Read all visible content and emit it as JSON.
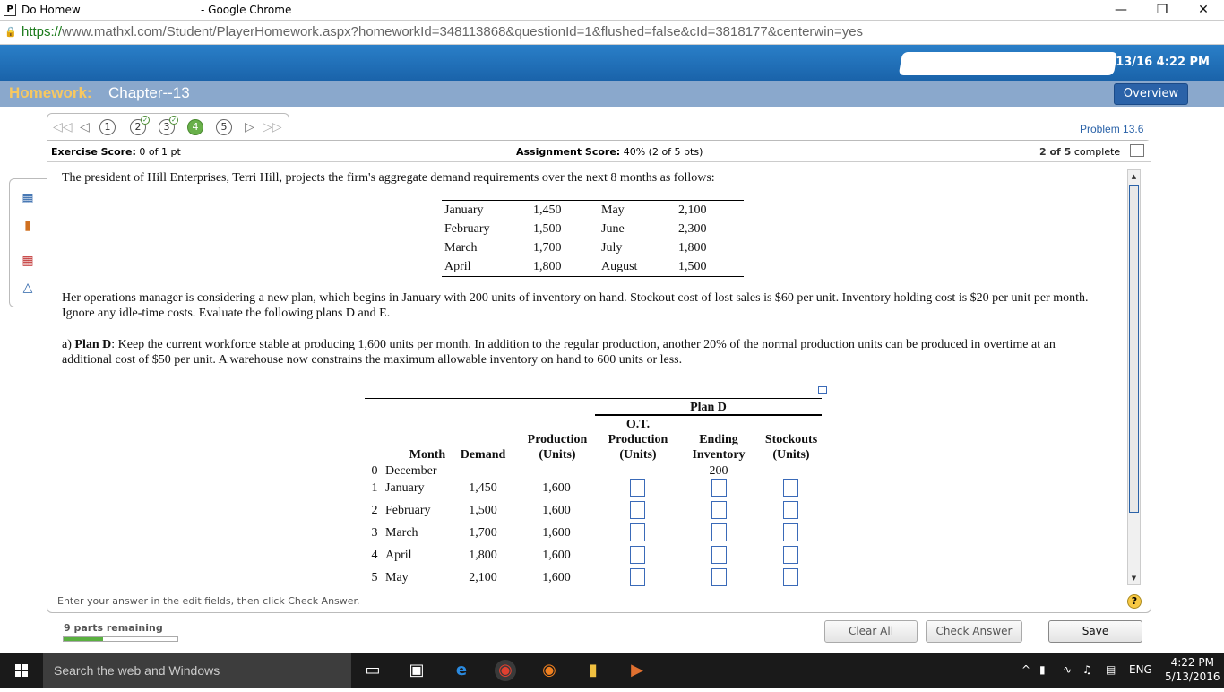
{
  "browser": {
    "favicon": "P",
    "tab_title": "Do Homew",
    "app_title": "- Google Chrome",
    "url_proto": "https://",
    "url_rest": "www.mathxl.com/Student/PlayerHomework.aspx?homeworkId=348113868&questionId=1&flushed=false&cId=3818177&centerwin=yes",
    "minimize": "—",
    "restore": "❐",
    "close": "✕"
  },
  "banner": {
    "datetime": "5/13/16 4:22 PM"
  },
  "homework": {
    "label": "Homework:",
    "chapter": "Chapter--13",
    "overview": "Overview"
  },
  "nav": {
    "questions": [
      "1",
      "2",
      "3",
      "4",
      "5"
    ],
    "problem": "Problem 13.6"
  },
  "score": {
    "exercise_label": "Exercise Score:",
    "exercise_value": "0 of 1 pt",
    "assignment_label": "Assignment Score:",
    "assignment_value": "40% (2 of 5 pts)",
    "complete_bold": "2 of 5",
    "complete_text": "complete"
  },
  "question": {
    "intro": "The president of Hill Enterprises, Terri Hill, projects the firm's aggregate demand requirements over the next 8 months as follows:",
    "demand": [
      {
        "m1": "January",
        "v1": "1,450",
        "m2": "May",
        "v2": "2,100"
      },
      {
        "m1": "February",
        "v1": "1,500",
        "m2": "June",
        "v2": "2,300"
      },
      {
        "m1": "March",
        "v1": "1,700",
        "m2": "July",
        "v2": "1,800"
      },
      {
        "m1": "April",
        "v1": "1,800",
        "m2": "August",
        "v2": "1,500"
      }
    ],
    "para2": "Her operations manager is considering a new plan, which begins in January with 200 units of inventory on hand. Stockout cost of lost sales is $60 per unit. Inventory holding cost is $20 per unit per month. Ignore any idle-time costs. Evaluate the following plans D and E.",
    "para3_prefix": "a) ",
    "para3_bold": "Plan D",
    "para3_rest": ": Keep the current workforce stable at producing 1,600 units per month. In addition to the regular production, another 20% of the normal production units can be produced in overtime at an additional cost of $50 per unit. A warehouse now constrains the maximum allowable inventory on hand to 600 units or less."
  },
  "plan": {
    "title": "Plan D",
    "headers": {
      "month": "Month",
      "demand": "Demand",
      "production": [
        "Production",
        "(Units)"
      ],
      "ot": [
        "O.T.",
        "Production",
        "(Units)"
      ],
      "ending": [
        "Ending",
        "Inventory"
      ],
      "stockouts": [
        "Stockouts",
        "(Units)"
      ]
    },
    "rows": [
      {
        "num": "0",
        "month": "December",
        "demand": "",
        "production": "",
        "ending": "200"
      },
      {
        "num": "1",
        "month": "January",
        "demand": "1,450",
        "production": "1,600"
      },
      {
        "num": "2",
        "month": "February",
        "demand": "1,500",
        "production": "1,600"
      },
      {
        "num": "3",
        "month": "March",
        "demand": "1,700",
        "production": "1,600"
      },
      {
        "num": "4",
        "month": "April",
        "demand": "1,800",
        "production": "1,600"
      },
      {
        "num": "5",
        "month": "May",
        "demand": "2,100",
        "production": "1,600"
      }
    ]
  },
  "footer": {
    "instruction": "Enter your answer in the edit fields, then click Check Answer.",
    "help": "?",
    "parts": "9 parts remaining",
    "progress_fraction": 0.35,
    "clear": "Clear All",
    "check": "Check Answer",
    "save": "Save"
  },
  "taskbar": {
    "search": "Search the web and Windows",
    "lang": "ENG",
    "time": "4:22 PM",
    "date": "5/13/2016"
  },
  "colors": {
    "banner": "#1d6db5",
    "hwbar": "#8aa8cc",
    "homework_label": "#f7c860",
    "active_question": "#69b04a"
  }
}
